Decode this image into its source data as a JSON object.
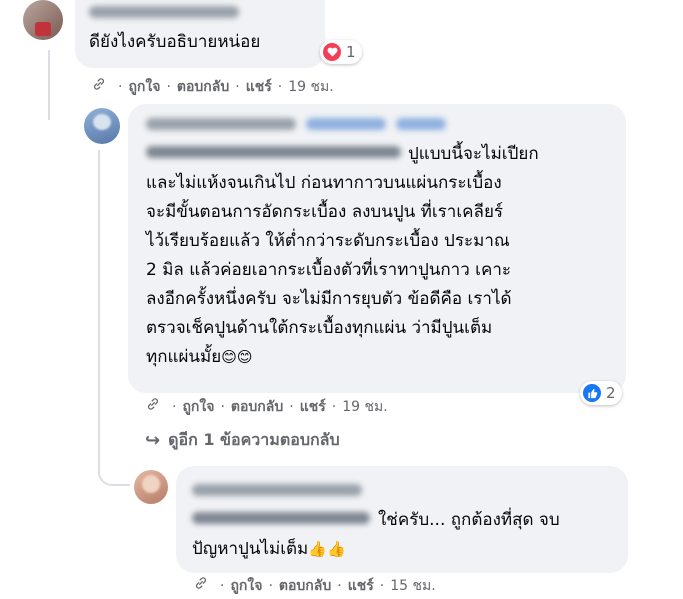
{
  "comments": [
    {
      "text": "ดียังไงครับอธิบายหน่อย",
      "reaction": {
        "type": "love",
        "count": "1"
      },
      "actions": {
        "like": "ถูกใจ",
        "reply": "ตอบกลับ",
        "share": "แชร์",
        "time": "19 ชม."
      }
    },
    {
      "text": "ปูแบบนี้จะไม่เปียก\nและไม่แห้งจนเกินไป ก่อนทากาวบนแผ่นกระเบื้อง\nจะมีขั้นตอนการอัดกระเบื้อง ลงบนปูน ที่เราเคลียร์\nไว้เรียบร้อยแล้ว ให้ต่ำกว่าระดับกระเบื้อง ประมาณ\n2 มิล แล้วค่อยเอากระเบื้องตัวที่เราทาปูนกาว เคาะ\nลงอีกครั้งหนึ่งครับ จะไม่มีการยุบตัว ข้อดีคือ เราได้\nตรวจเช็คปูนด้านใต้กระเบื้องทุกแผ่น ว่ามีปูนเต็ม\nทุกแผ่นมั้ย",
      "emoji": "😊😊",
      "reaction": {
        "type": "like",
        "count": "2"
      },
      "actions": {
        "like": "ถูกใจ",
        "reply": "ตอบกลับ",
        "share": "แชร์",
        "time": "19 ชม."
      },
      "more_replies": "ดูอีก 1 ข้อความตอบกลับ"
    },
    {
      "text": "ใช่ครับ... ถูกต้องที่สุด จบ\nปัญหาปูนไม่เต็ม",
      "emoji": "👍👍",
      "actions": {
        "like": "ถูกใจ",
        "reply": "ตอบกลับ",
        "share": "แชร์",
        "time": "15 ชม."
      }
    }
  ],
  "colors": {
    "bubble": "#f0f2f5",
    "meta": "#65676b",
    "love": "#f33e58",
    "like": "#1877f2"
  },
  "icons": [
    "link-icon",
    "heart-icon",
    "thumbs-up-icon",
    "reply-arrow-icon"
  ]
}
